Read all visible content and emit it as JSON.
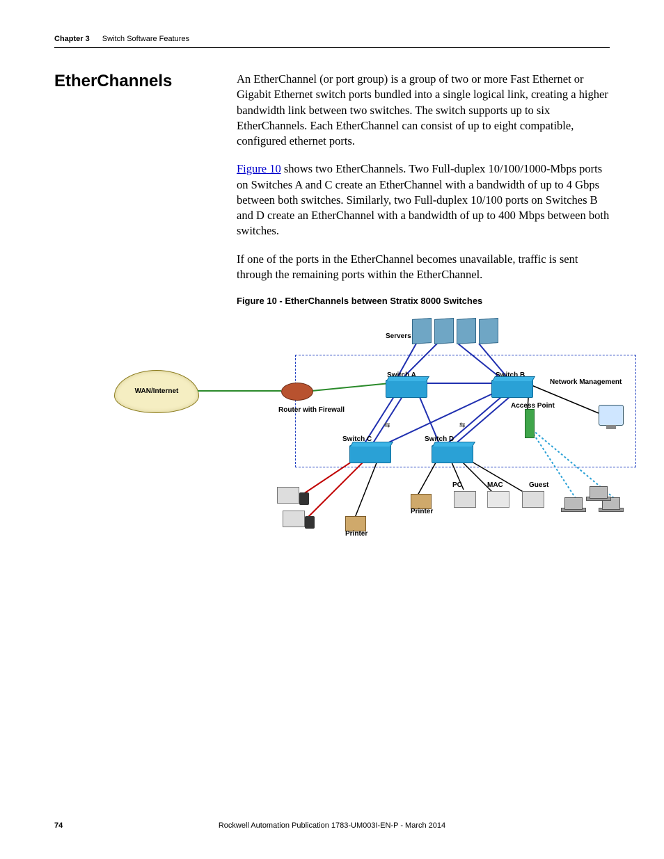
{
  "header": {
    "chapter_label": "Chapter 3",
    "chapter_title": "Switch Software Features"
  },
  "section": {
    "heading": "EtherChannels",
    "para1": "An EtherChannel (or port group) is a group of two or more Fast Ethernet or Gigabit Ethernet switch ports bundled into a single logical link, creating a higher bandwidth link between two switches. The switch supports up to six EtherChannels. Each EtherChannel can consist of up to eight compatible, configured ethernet ports.",
    "figure_link_text": "Figure 10",
    "para2_after_link": " shows two EtherChannels. Two Full-duplex 10/100/1000-Mbps ports on Switches A and C create an EtherChannel with a bandwidth of up to 4 Gbps between both switches. Similarly, two Full-duplex 10/100 ports on Switches B and D create an EtherChannel with a bandwidth of up to 400 Mbps between both switches.",
    "para3": "If one of the ports in the EtherChannel becomes unavailable, traffic is sent through the remaining ports within the EtherChannel.",
    "figure_caption": "Figure 10 - EtherChannels between Stratix 8000 Switches"
  },
  "diagram": {
    "wan_label": "WAN/Internet",
    "servers_label": "Servers",
    "switch_a": "Switch A",
    "switch_b": "Switch B",
    "switch_c": "Switch C",
    "switch_d": "Switch D",
    "router_label": "Router with Firewall",
    "network_mgmt": "Network Management",
    "access_point": "Access Point",
    "pc": "PC",
    "mac": "MAC",
    "guest": "Guest",
    "printer": "Printer"
  },
  "footer": {
    "page_number": "74",
    "publication": "Rockwell Automation Publication 1783-UM003I-EN-P - March 2014"
  }
}
